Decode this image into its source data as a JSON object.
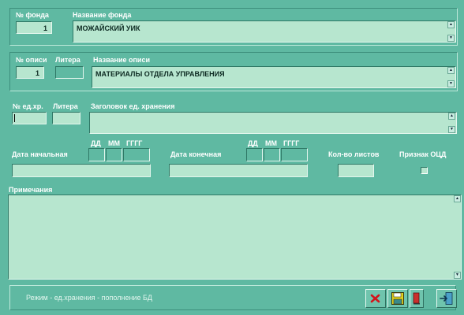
{
  "fond": {
    "number_label": "№ фонда",
    "number_value": "1",
    "name_label": "Название фонда",
    "name_value": "МОЖАЙСКИЙ  УИК"
  },
  "opis": {
    "number_label": "№ описи",
    "number_value": "1",
    "litera_label": "Литера",
    "litera_value": "",
    "name_label": "Название описи",
    "name_value": "МАТЕРИАЛЫ ОТДЕЛА УПРАВЛЕНИЯ"
  },
  "item": {
    "number_label": "№ ед.хр.",
    "number_value": "",
    "litera_label": "Литера",
    "litera_value": "",
    "title_label": "Заголовок ед. хранения",
    "title_value": ""
  },
  "dates": {
    "dd_label": "ДД",
    "mm_label": "ММ",
    "yyyy_label": "ГГГГ",
    "start_label": "Дата начальная",
    "end_label": "Дата конечная",
    "sheets_label": "Кол-во листов",
    "ocd_label": "Признак ОЦД"
  },
  "notes": {
    "label": "Примечания",
    "value": ""
  },
  "status": {
    "mode_text": "Режим - ед.хранения - пополнение БД"
  },
  "colors": {
    "background": "#5fb9a2",
    "field": "#b7e6cf",
    "delete_icon": "#d4141a",
    "save_icon": "#e0d020"
  }
}
